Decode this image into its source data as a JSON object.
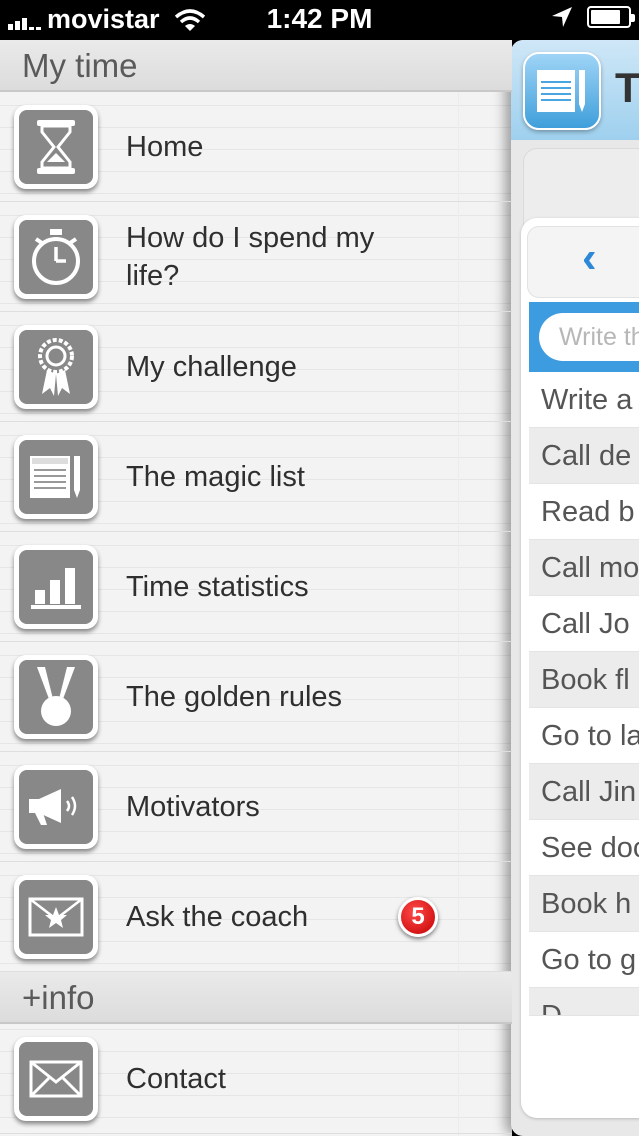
{
  "status_bar": {
    "carrier": "movistar",
    "time": "1:42 PM"
  },
  "menu": {
    "sections": [
      {
        "title": "My time",
        "items": [
          {
            "label": "Home",
            "icon": "hourglass-icon"
          },
          {
            "label": "How do I spend my life?",
            "icon": "stopwatch-icon"
          },
          {
            "label": "My challenge",
            "icon": "award-ribbon-icon"
          },
          {
            "label": "The magic list",
            "icon": "notepad-pencil-icon"
          },
          {
            "label": "Time statistics",
            "icon": "bar-chart-icon"
          },
          {
            "label": "The golden rules",
            "icon": "medal-icon"
          },
          {
            "label": "Motivators",
            "icon": "megaphone-icon"
          },
          {
            "label": "Ask the coach",
            "icon": "star-envelope-icon",
            "badge": "5"
          }
        ]
      },
      {
        "title": "+info",
        "items": [
          {
            "label": "Contact",
            "icon": "envelope-icon"
          }
        ]
      }
    ]
  },
  "main_panel": {
    "title_fragment": "T",
    "back_label": "‹",
    "search_placeholder": "Write th",
    "tasks": [
      "Write a",
      "Call de",
      "Read b",
      "Call mo",
      "Call Jo",
      "Book fl",
      "Go to la",
      "Call Jin",
      "See doc",
      "Book h",
      "Go to g",
      "D"
    ]
  },
  "colors": {
    "icon_gray": "#888888",
    "badge_red": "#d40000",
    "accent_blue": "#3d9be0"
  }
}
